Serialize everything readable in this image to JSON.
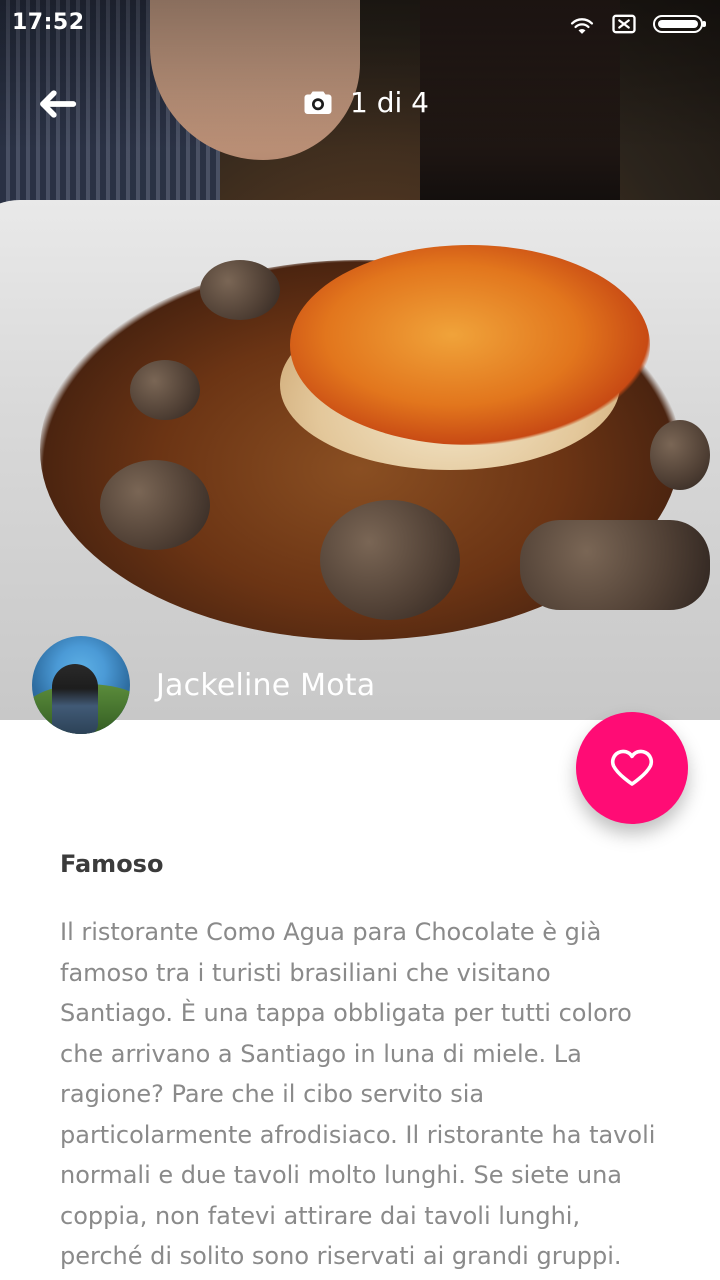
{
  "status_bar": {
    "time": "17:52",
    "icons": [
      "wifi-icon",
      "no-sim-icon",
      "battery-icon"
    ]
  },
  "app_bar": {
    "back_icon": "arrow-left-icon",
    "camera_icon": "camera-icon",
    "photo_counter": "1 di 4"
  },
  "hero": {
    "author_name": "Jackeline Mota"
  },
  "actions": {
    "like_icon": "heart-outline-icon",
    "accent_color": "#ff0c75"
  },
  "article": {
    "title": "Famoso",
    "paragraph": "Il ristorante Como Agua para Chocolate è già famoso tra i turisti brasiliani che visitano Santiago. È una tappa obbligata per tutti coloro che arrivano a Santiago in luna di miele. La ragione? Pare che il cibo servito sia particolarmente afrodisiaco. Il ristorante ha tavoli normali e due tavoli molto lunghi. Se siete una coppia, non fatevi attirare dai tavoli lunghi, perché di solito sono riservati ai grandi gruppi."
  }
}
